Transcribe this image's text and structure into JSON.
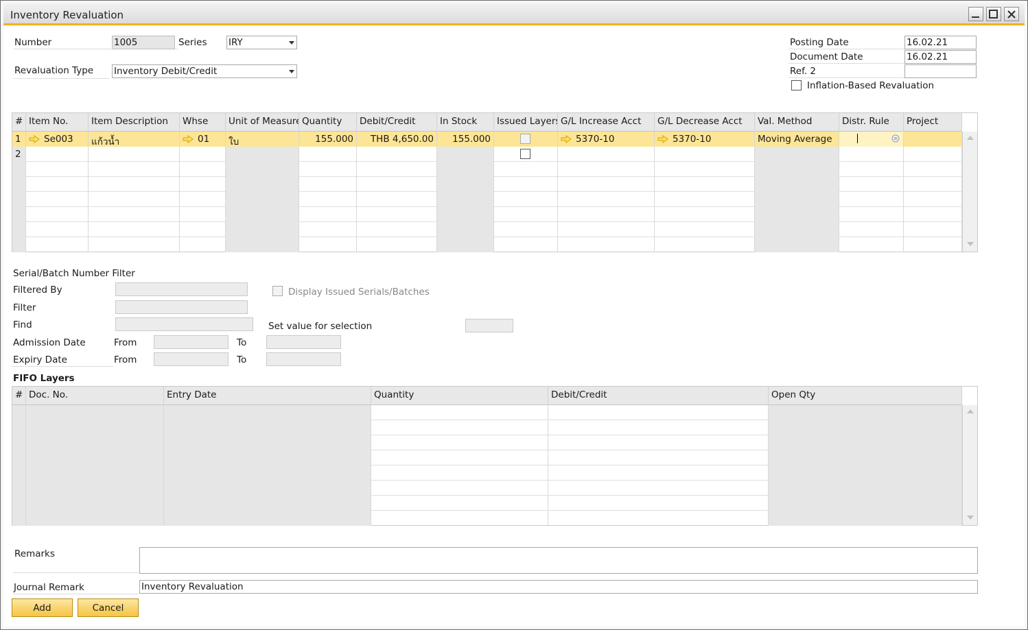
{
  "window": {
    "title": "Inventory Revaluation"
  },
  "header": {
    "number_label": "Number",
    "number_value": "1005",
    "series_label": "Series",
    "series_value": "IRY",
    "reval_type_label": "Revaluation Type",
    "reval_type_value": "Inventory Debit/Credit",
    "posting_date_label": "Posting Date",
    "posting_date_value": "16.02.21",
    "document_date_label": "Document Date",
    "document_date_value": "16.02.21",
    "ref2_label": "Ref. 2",
    "ref2_value": "",
    "inflation_label": "Inflation-Based Revaluation",
    "inflation_checked": false
  },
  "items_grid": {
    "columns": [
      "#",
      "Item No.",
      "Item Description",
      "Whse",
      "Unit of Measure",
      "Quantity",
      "Debit/Credit",
      "In Stock",
      "Issued Layers",
      "G/L Increase Acct",
      "G/L Decrease Acct",
      "Val. Method",
      "Distr. Rule",
      "Project"
    ],
    "rows": [
      {
        "num": "1",
        "item_no": "Se003",
        "description": "แก้วน้ำ",
        "whse": "01",
        "uom": "ใบ",
        "quantity": "155.000",
        "debit_credit": "THB 4,650.00",
        "in_stock": "155.000",
        "issued_layers": false,
        "gl_increase": "5370-10",
        "gl_decrease": "5370-10",
        "val_method": "Moving Average",
        "distr_rule": "",
        "project": ""
      },
      {
        "num": "2",
        "item_no": "",
        "description": "",
        "whse": "",
        "uom": "",
        "quantity": "",
        "debit_credit": "",
        "in_stock": "",
        "issued_layers": false,
        "gl_increase": "",
        "gl_decrease": "",
        "val_method": "",
        "distr_rule": "",
        "project": ""
      }
    ]
  },
  "filter": {
    "section_label": "Serial/Batch Number Filter",
    "filtered_by_label": "Filtered By",
    "filter_label": "Filter",
    "find_label": "Find",
    "display_issued_label": "Display Issued Serials/Batches",
    "set_value_label": "Set value for selection",
    "admission_date_label": "Admission Date",
    "expiry_date_label": "Expiry Date",
    "from_label": "From",
    "to_label": "To"
  },
  "fifo": {
    "title": "FIFO Layers",
    "columns": [
      "#",
      "Doc. No.",
      "Entry Date",
      "Quantity",
      "Debit/Credit",
      "Open Qty"
    ]
  },
  "footer": {
    "remarks_label": "Remarks",
    "remarks_value": "",
    "journal_remark_label": "Journal Remark",
    "journal_remark_value": "Inventory Revaluation",
    "add_button": "Add",
    "cancel_button": "Cancel"
  },
  "colors": {
    "accent": "#f1b418",
    "selected_row": "#fce596",
    "button": "#f5c542"
  }
}
